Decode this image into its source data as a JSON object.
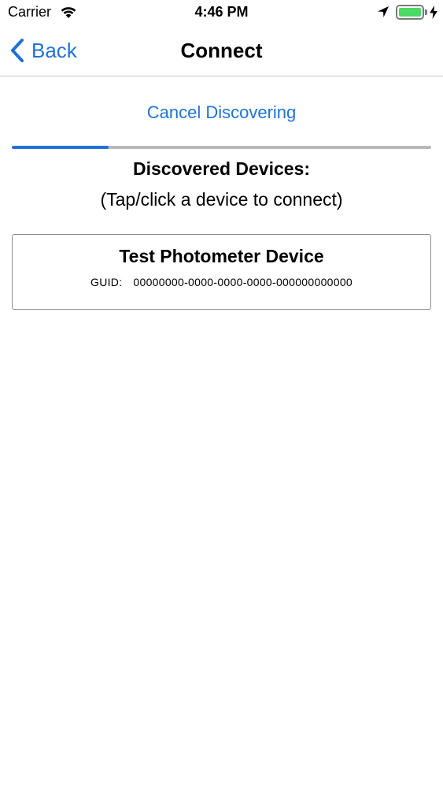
{
  "status_bar": {
    "carrier": "Carrier",
    "time": "4:46 PM",
    "battery_level": 1.0,
    "battery_color": "#4cd964"
  },
  "nav": {
    "back_label": "Back",
    "title": "Connect",
    "accent_color": "#1f73d6"
  },
  "discovery": {
    "cancel_label": "Cancel Discovering",
    "progress": 0.23,
    "title": "Discovered Devices:",
    "hint": "(Tap/click a device to connect)"
  },
  "devices": [
    {
      "name": "Test Photometer Device",
      "guid_label": "GUID:",
      "guid": "00000000-0000-0000-0000-000000000000"
    }
  ],
  "icons": [
    "wifi-icon",
    "location-arrow-icon",
    "battery-icon",
    "charging-bolt-icon",
    "chevron-left-icon"
  ]
}
